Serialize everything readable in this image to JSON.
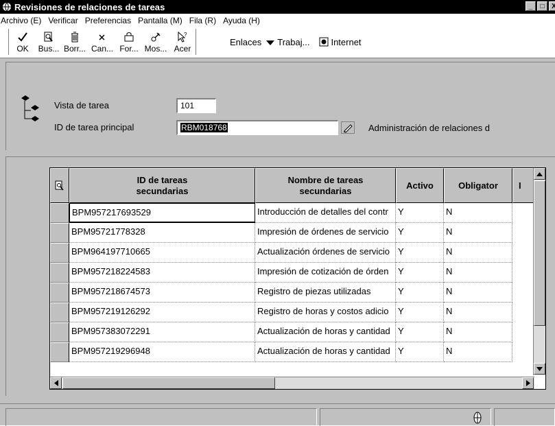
{
  "window": {
    "title": "Revisiones de relaciones de tareas",
    "controls": [
      "_",
      "□",
      "X"
    ]
  },
  "menubar": {
    "items": [
      "Archivo (E)",
      "Verificar",
      "Preferencias",
      "Pantalla (M)",
      "Fila (R)",
      "Ayuda (H)"
    ]
  },
  "toolbar": {
    "buttons": [
      {
        "label": "OK",
        "icon": "check-icon"
      },
      {
        "label": "Bus...",
        "icon": "find-icon"
      },
      {
        "label": "Borr...",
        "icon": "trash-icon"
      },
      {
        "label": "Can...",
        "icon": "close-icon"
      },
      {
        "label": "For...",
        "icon": "form-icon"
      },
      {
        "label": "Mos...",
        "icon": "show-icon"
      },
      {
        "label": "Acer",
        "icon": "help-cursor-icon"
      }
    ],
    "links": {
      "enlaces": "Enlaces",
      "trabaj": "Trabaj...",
      "internet": "Internet"
    }
  },
  "header": {
    "vista_label": "Vista de tarea",
    "vista_value": "101",
    "id_label": "ID de tarea principal",
    "id_value": "RBM018768",
    "description": "Administración de relaciones d"
  },
  "grid": {
    "columns": [
      "ID de tareas\nsecundarias",
      "Nombre de tareas\nsecundarias",
      "Activo",
      "Obligator"
    ],
    "rows": [
      {
        "id": "BPM957217693529",
        "name": "Introducción de detalles del contr",
        "activo": "Y",
        "obligatorio": "N"
      },
      {
        "id": "BPM95721778328",
        "name": "Impresión de órdenes de servicio",
        "activo": "Y",
        "obligatorio": "N"
      },
      {
        "id": "BPM964197710665",
        "name": "Actualización órdenes de servicio",
        "activo": "Y",
        "obligatorio": "N"
      },
      {
        "id": "BPM957218224583",
        "name": "Impresión de cotización de órden",
        "activo": "Y",
        "obligatorio": "N"
      },
      {
        "id": "BPM957218674573",
        "name": "Registro de piezas utilizadas",
        "activo": "Y",
        "obligatorio": "N"
      },
      {
        "id": "BPM957219126292",
        "name": "Registro de horas y costos adicio",
        "activo": "Y",
        "obligatorio": "N"
      },
      {
        "id": "BPM957383072291",
        "name": "Actualización de horas y cantidad",
        "activo": "Y",
        "obligatorio": "N"
      },
      {
        "id": "BPM957219296948",
        "name": "Actualización de horas y cantidad",
        "activo": "Y",
        "obligatorio": "N"
      }
    ]
  },
  "colors": {
    "titlebar": "#000000",
    "face": "#c0c0c0",
    "window": "#ffffff"
  }
}
